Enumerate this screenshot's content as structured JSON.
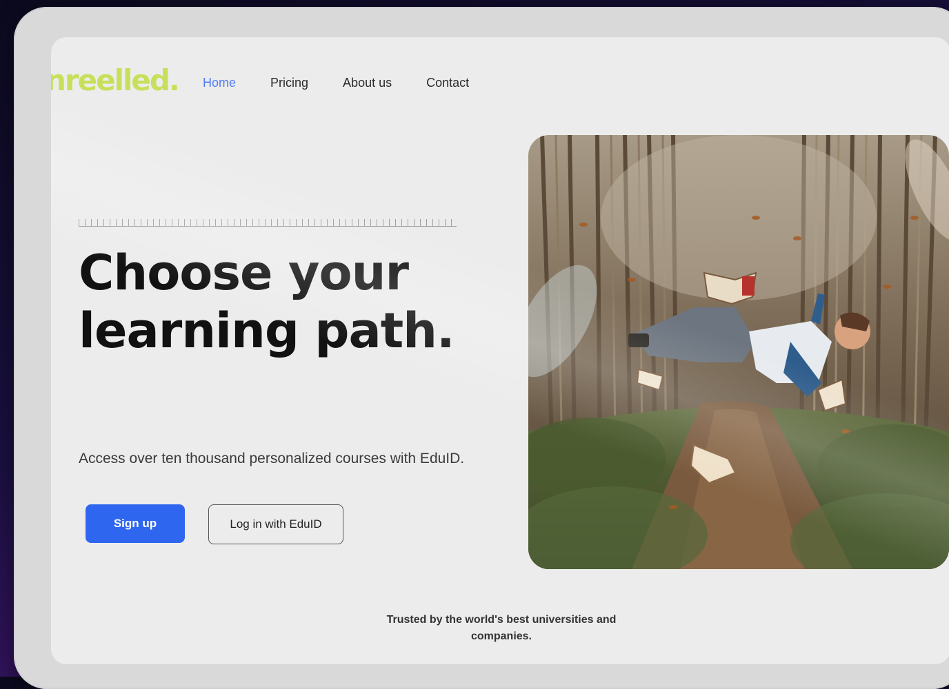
{
  "brand": {
    "logo_text": "nreelled.",
    "accent_color": "#c6e05a"
  },
  "nav": {
    "items": [
      {
        "label": "Home",
        "active": true
      },
      {
        "label": "Pricing",
        "active": false
      },
      {
        "label": "About us",
        "active": false
      },
      {
        "label": "Contact",
        "active": false
      }
    ]
  },
  "hero": {
    "headline": "Choose your learning path.",
    "subtitle": "Access over ten thousand personalized courses with EduID.",
    "signup_label": "Sign up",
    "login_label": "Log in with EduID",
    "image_icon": "photo-forest-books"
  },
  "footer": {
    "trusted_text": "Trusted by the world's best universities and companies."
  },
  "colors": {
    "primary": "#2f66f0",
    "nav_active": "#4f7cf4",
    "screen_bg": "#ececec"
  }
}
